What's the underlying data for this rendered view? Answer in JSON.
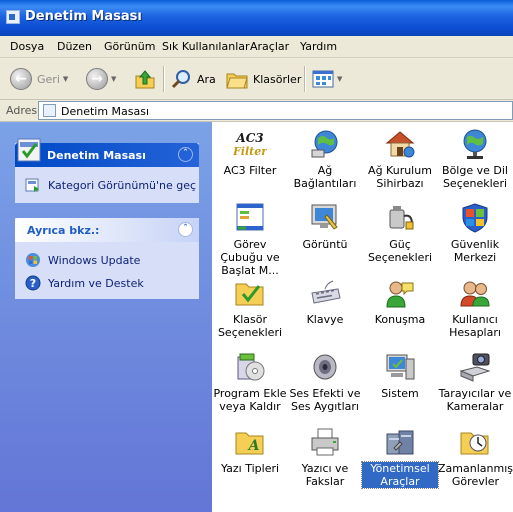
{
  "window": {
    "title": "Denetim Masası"
  },
  "menu": [
    "Dosya",
    "Düzen",
    "Görünüm",
    "Sık Kullanılanlar",
    "Araçlar",
    "Yardım"
  ],
  "toolbar": {
    "back": "Geri",
    "search": "Ara",
    "folders": "Klasörler"
  },
  "address": {
    "label": "Adres",
    "value": "Denetim Masası"
  },
  "left_pane": {
    "control_panel": {
      "title": "Denetim Masası",
      "link": "Kategori Görünümü'ne geç"
    },
    "see_also": {
      "title": "Ayrıca bkz.:",
      "links": [
        "Windows Update",
        "Yardım ve Destek"
      ]
    }
  },
  "items": [
    {
      "label": "AC3 Filter",
      "icon": "ac3-filter-icon",
      "selected": false
    },
    {
      "label": "Ağ Bağlantıları",
      "icon": "network-connections-icon",
      "selected": false
    },
    {
      "label": "Ağ Kurulum Sihirbazı",
      "icon": "network-setup-wizard-icon",
      "selected": false
    },
    {
      "label": "Bölge ve Dil Seçenekleri",
      "icon": "region-language-icon",
      "selected": false
    },
    {
      "label": "Görev Çubuğu ve Başlat M...",
      "icon": "taskbar-start-menu-icon",
      "selected": false
    },
    {
      "label": "Görüntü",
      "icon": "display-icon",
      "selected": false
    },
    {
      "label": "Güç Seçenekleri",
      "icon": "power-options-icon",
      "selected": false
    },
    {
      "label": "Güvenlik Merkezi",
      "icon": "security-center-icon",
      "selected": false
    },
    {
      "label": "Klasör Seçenekleri",
      "icon": "folder-options-icon",
      "selected": false
    },
    {
      "label": "Klavye",
      "icon": "keyboard-icon",
      "selected": false
    },
    {
      "label": "Konuşma",
      "icon": "speech-icon",
      "selected": false
    },
    {
      "label": "Kullanıcı Hesapları",
      "icon": "user-accounts-icon",
      "selected": false
    },
    {
      "label": "Program Ekle veya Kaldır",
      "icon": "add-remove-programs-icon",
      "selected": false
    },
    {
      "label": "Ses Efekti ve Ses Aygıtları",
      "icon": "sounds-audio-icon",
      "selected": false
    },
    {
      "label": "Sistem",
      "icon": "system-icon",
      "selected": false
    },
    {
      "label": "Tarayıcılar ve Kameralar",
      "icon": "scanners-cameras-icon",
      "selected": false
    },
    {
      "label": "Yazı Tipleri",
      "icon": "fonts-icon",
      "selected": false
    },
    {
      "label": "Yazıcı ve Fakslar",
      "icon": "printers-faxes-icon",
      "selected": false
    },
    {
      "label": "Yönetimsel Araçlar",
      "icon": "administrative-tools-icon",
      "selected": true
    },
    {
      "label": "Zamanlanmış Görevler",
      "icon": "scheduled-tasks-icon",
      "selected": false
    }
  ],
  "colors": {
    "title_bar": "#0a4fd4",
    "left_pane": "#6e8fe0",
    "selection": "#316ac5",
    "link": "#0c1f75"
  }
}
